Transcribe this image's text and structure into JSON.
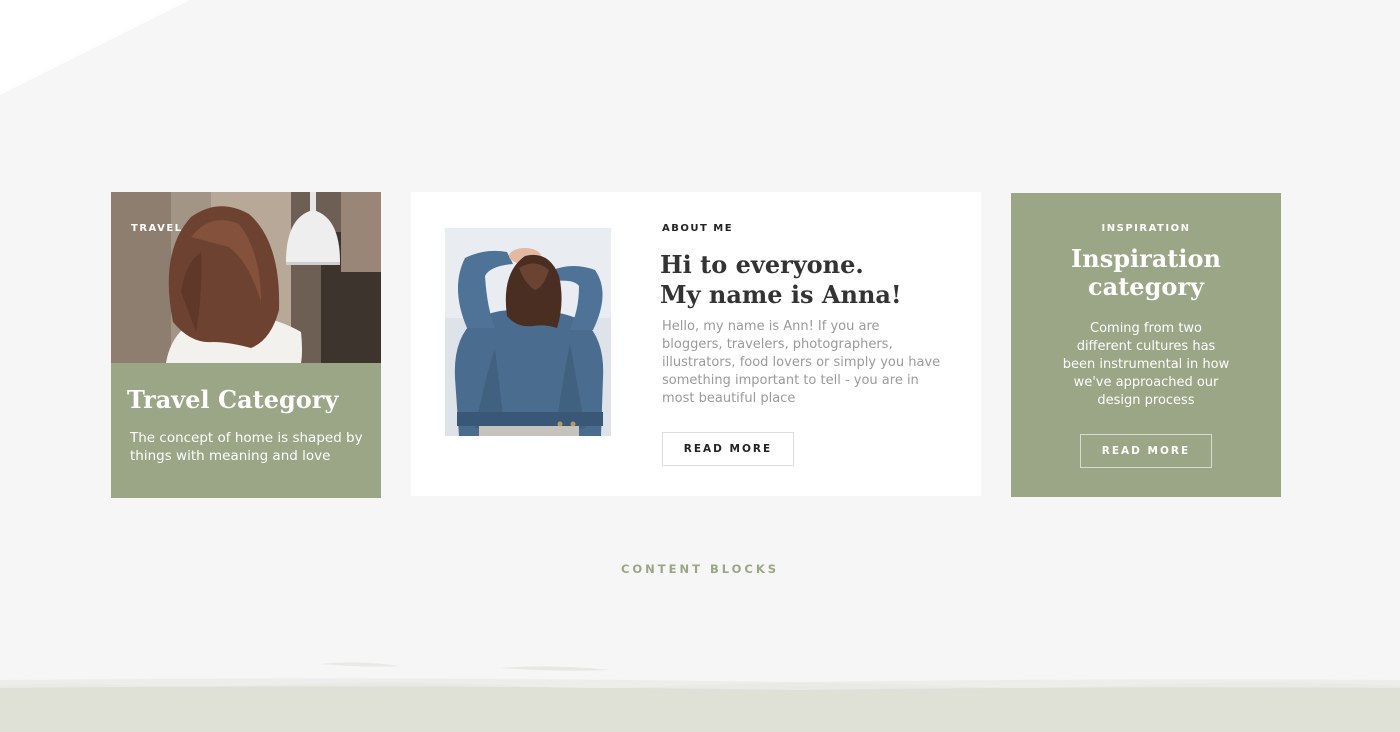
{
  "colors": {
    "background": "#f6f6f6",
    "accent_green": "#9aa685",
    "card_white": "#ffffff",
    "footer_band": "#dfe0d7"
  },
  "travel_card": {
    "tag": "TRAVEL",
    "title": "Travel Category",
    "description": "The concept of home is shaped by things with meaning and love",
    "image": "woman-with-long-hair-photo"
  },
  "about_card": {
    "tag": "ABOUT ME",
    "title_line1": "Hi to everyone.",
    "title_line2": "My name is Anna!",
    "description": "Hello, my name is Ann! If you are bloggers, travelers, photographers, illustrators, food lovers or simply you have something important to tell - you are in most beautiful place",
    "button_label": "READ MORE",
    "image": "woman-in-denim-jacket-photo"
  },
  "inspiration_card": {
    "tag": "INSPIRATION",
    "title_line1": "Inspiration",
    "title_line2": "category",
    "description": "Coming from two different cultures has been instrumental in how we've approached our design process",
    "button_label": "READ MORE"
  },
  "section": {
    "label": "CONTENT BLOCKS"
  }
}
